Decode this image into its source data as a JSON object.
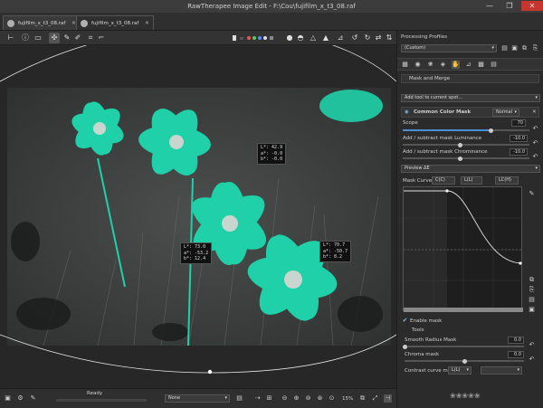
{
  "window": {
    "title": "RawTherapee Image Edit - F:\\Cou\\fujifilm_x_t3_08.raf",
    "minimize": "—",
    "maximize": "❐",
    "close": "✕"
  },
  "tabs": [
    {
      "label": "fujifilm_x_t3_08.raf",
      "close": "✕"
    },
    {
      "label": "fujifilm_x_t3_08.raf",
      "close": "✕"
    }
  ],
  "probes": [
    {
      "l": "L*: 42.9",
      "a": "a*: -0.0",
      "b": "b*: -0.0"
    },
    {
      "l": "L*: 73.0",
      "a": "a*: -53.2",
      "b": "b*: 12.4"
    },
    {
      "l": "L*: 70.7",
      "a": "a*: -50.7",
      "b": "b*: 8.2"
    }
  ],
  "status": {
    "ready": "Ready",
    "preset": "None",
    "zoom": "15%"
  },
  "panel": {
    "header": "Processing Profiles",
    "profile": "(Custom)",
    "module_title": "Mask and Merge",
    "add_tool": "Add tool to current spot...",
    "section": {
      "title": "Common Color Mask",
      "mode": "Normal"
    },
    "sliders": [
      {
        "label": "Scope",
        "value": "70",
        "fraction": 0.7
      },
      {
        "label": "Add / subtract mask Luminance",
        "value": "-10.0",
        "fraction": 0.45
      },
      {
        "label": "Add / subtract mask Chrominance",
        "value": "-10.0",
        "fraction": 0.45
      }
    ],
    "preview": "Preview ΔE",
    "mask_curves": {
      "label": "Mask Curves",
      "tab1": "C(C)",
      "tab2": "L(L)",
      "tab3": "LC(H)"
    },
    "enable_mask": "Enable mask",
    "tools_label": "Tools",
    "smooth_radius": {
      "label": "Smooth Radius Mask",
      "value": "0.0",
      "fraction": 0.0
    },
    "chroma_mask": {
      "label": "Chroma mask",
      "value": "0.0",
      "fraction": 0.5
    },
    "contrast_curve": {
      "label": "Contrast curve mask",
      "option": "L(L)"
    }
  },
  "colors": {
    "accent": "#4a8fd6",
    "mask_teal": "#1fd0a8",
    "bg": "#2b2b2b"
  }
}
